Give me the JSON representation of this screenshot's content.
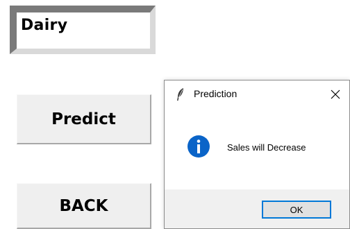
{
  "entry": {
    "value": "Dairy"
  },
  "buttons": {
    "predict_label": "Predict",
    "back_label": "BACK"
  },
  "dialog": {
    "title": "Prediction",
    "title_icon": "feather-icon",
    "close_glyph": "✕",
    "message_icon": "info-icon",
    "message": "Sales will Decrease",
    "ok_label": "OK"
  },
  "colors": {
    "info_blue": "#0a64c8",
    "ok_focus_border": "#0078d7",
    "button_face": "#efefef",
    "dialog_footer": "#f0f0f0"
  }
}
